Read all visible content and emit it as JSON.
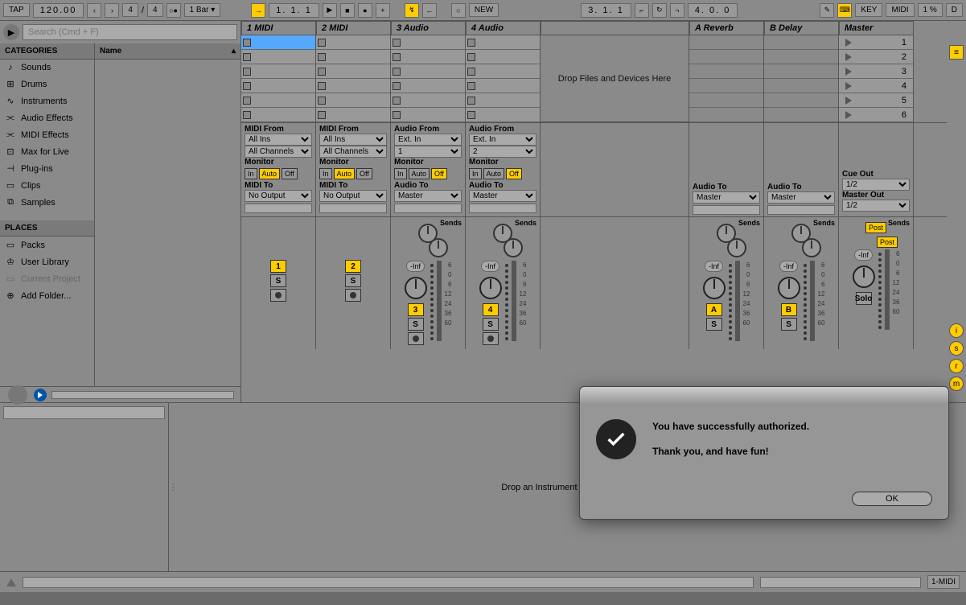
{
  "topbar": {
    "tap": "TAP",
    "tempo": "120.00",
    "sig_num": "4",
    "sig_den": "4",
    "quantize": "1 Bar",
    "position": "1.  1.  1",
    "loop_pos": "3.  1.  1",
    "loop_len": "4.  0.  0",
    "key": "KEY",
    "midi": "MIDI",
    "cpu": "1 %",
    "d": "D"
  },
  "search": {
    "placeholder": "Search (Cmd + F)"
  },
  "categories": {
    "header": "CATEGORIES",
    "items": [
      {
        "icon": "♪",
        "label": "Sounds"
      },
      {
        "icon": "⊞",
        "label": "Drums"
      },
      {
        "icon": "∿",
        "label": "Instruments"
      },
      {
        "icon": "⫘",
        "label": "Audio Effects"
      },
      {
        "icon": "⫘",
        "label": "MIDI Effects"
      },
      {
        "icon": "⊡",
        "label": "Max for Live"
      },
      {
        "icon": "⊣",
        "label": "Plug-ins"
      },
      {
        "icon": "▭",
        "label": "Clips"
      },
      {
        "icon": "⧉",
        "label": "Samples"
      }
    ]
  },
  "places": {
    "header": "PLACES",
    "items": [
      {
        "icon": "▭",
        "label": "Packs",
        "disabled": false
      },
      {
        "icon": "♔",
        "label": "User Library",
        "disabled": false
      },
      {
        "icon": "▭",
        "label": "Current Project",
        "disabled": true
      },
      {
        "icon": "⊕",
        "label": "Add Folder...",
        "disabled": false
      }
    ]
  },
  "name_header": "Name",
  "tracks": [
    {
      "name": "1 MIDI",
      "from_label": "MIDI From",
      "from": "All Ins",
      "chan": "All Channels",
      "monitor": "Auto",
      "to_label": "MIDI To",
      "to": "No Output",
      "num": "1",
      "sends": false
    },
    {
      "name": "2 MIDI",
      "from_label": "MIDI From",
      "from": "All Ins",
      "chan": "All Channels",
      "monitor": "Auto",
      "to_label": "MIDI To",
      "to": "No Output",
      "num": "2",
      "sends": false
    },
    {
      "name": "3 Audio",
      "from_label": "Audio From",
      "from": "Ext. In",
      "chan": "1",
      "monitor": "Off",
      "to_label": "Audio To",
      "to": "Master",
      "num": "3",
      "sends": true
    },
    {
      "name": "4 Audio",
      "from_label": "Audio From",
      "from": "Ext. In",
      "chan": "2",
      "monitor": "Off",
      "to_label": "Audio To",
      "to": "Master",
      "num": "4",
      "sends": true
    }
  ],
  "returns": [
    {
      "name": "A Reverb",
      "to_label": "Audio To",
      "to": "Master",
      "num": "A"
    },
    {
      "name": "B Delay",
      "to_label": "Audio To",
      "to": "Master",
      "num": "B"
    }
  ],
  "master": {
    "name": "Master",
    "cue_label": "Cue Out",
    "cue": "1/2",
    "out_label": "Master Out",
    "out": "1/2",
    "solo": "Solo"
  },
  "scenes": [
    "1",
    "2",
    "3",
    "4",
    "5",
    "6"
  ],
  "drop_tracks": "Drop Files and Devices Here",
  "drop_device": "Drop an Instrument or Sample Here",
  "labels": {
    "monitor": "Monitor",
    "in": "In",
    "auto": "Auto",
    "off": "Off",
    "sends": "Sends",
    "solo": "S",
    "inf": "-Inf",
    "post": "Post",
    "new": "NEW"
  },
  "db_scale": [
    "6",
    "0",
    "6",
    "12",
    "24",
    "36",
    "60"
  ],
  "status": {
    "midi": "1-MIDI"
  },
  "dialog": {
    "line1": "You have successfully authorized.",
    "line2": "Thank you, and have fun!",
    "ok": "OK"
  }
}
